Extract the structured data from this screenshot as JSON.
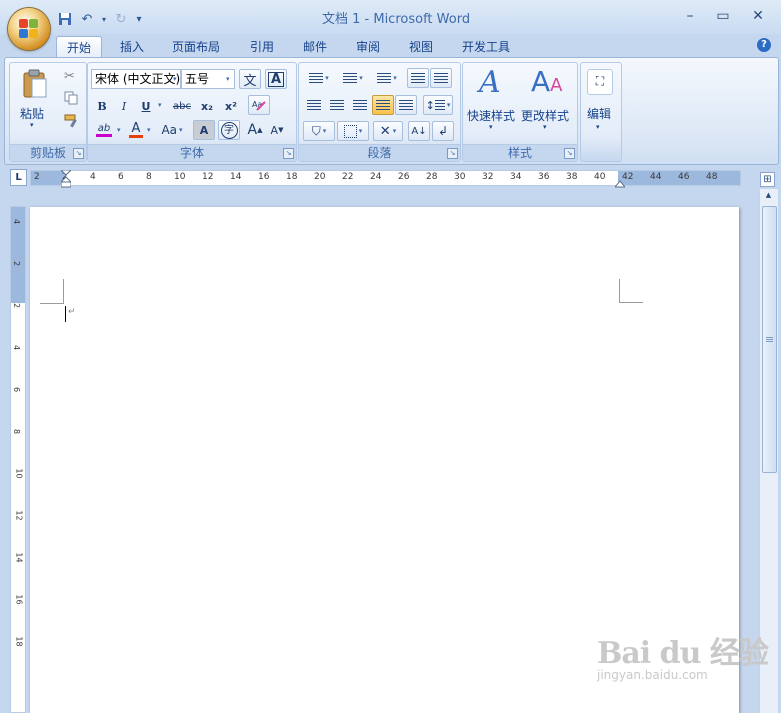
{
  "window": {
    "title": "文档 1 - Microsoft Word",
    "controls": {
      "minimize": "–",
      "maximize": "▭",
      "close": "✕"
    }
  },
  "quick_access": {
    "save_icon": "save-icon",
    "undo_icon": "undo-icon",
    "redo_icon": "redo-icon",
    "customize": "▾"
  },
  "tabs": [
    "开始",
    "插入",
    "页面布局",
    "引用",
    "邮件",
    "审阅",
    "视图",
    "开发工具"
  ],
  "active_tab": "开始",
  "ribbon": {
    "clipboard": {
      "label": "剪贴板",
      "paste_label": "粘贴"
    },
    "font": {
      "label": "字体",
      "font_name": "宋体 (中文正文)",
      "font_size": "五号",
      "phonetic_glyph": "文",
      "char_border_glyph": "A",
      "bold": "B",
      "italic": "I",
      "underline": "U",
      "strike": "abc",
      "subscript": "x₂",
      "superscript": "x²",
      "highlight_glyph": "ab",
      "font_color_glyph": "A",
      "change_case": "Aa",
      "char_shading_glyph": "A",
      "enclose_glyph": "字",
      "grow_glyph": "A",
      "shrink_glyph": "A"
    },
    "paragraph": {
      "label": "段落"
    },
    "styles": {
      "label": "样式",
      "quick_styles": "快速样式",
      "change_styles": "更改样式"
    },
    "editing": {
      "label": "编辑"
    }
  },
  "ruler": {
    "h_ticks": [
      "2",
      "2",
      "4",
      "6",
      "8",
      "10",
      "12",
      "14",
      "16",
      "18",
      "20",
      "22",
      "24",
      "26",
      "28",
      "30",
      "32",
      "34",
      "36",
      "38",
      "40",
      "42",
      "44",
      "46",
      "48"
    ],
    "v_ticks": [
      "4",
      "2",
      "2",
      "4",
      "6",
      "8",
      "10",
      "12",
      "14",
      "16",
      "18"
    ],
    "corner_glyph": "L"
  },
  "watermark": {
    "logo_text": "Bai du 经验",
    "url": "jingyan.baidu.com"
  },
  "colors": {
    "ribbon_text": "#15428b",
    "accent_highlight": "#f7c14d",
    "page": "#ffffff"
  }
}
